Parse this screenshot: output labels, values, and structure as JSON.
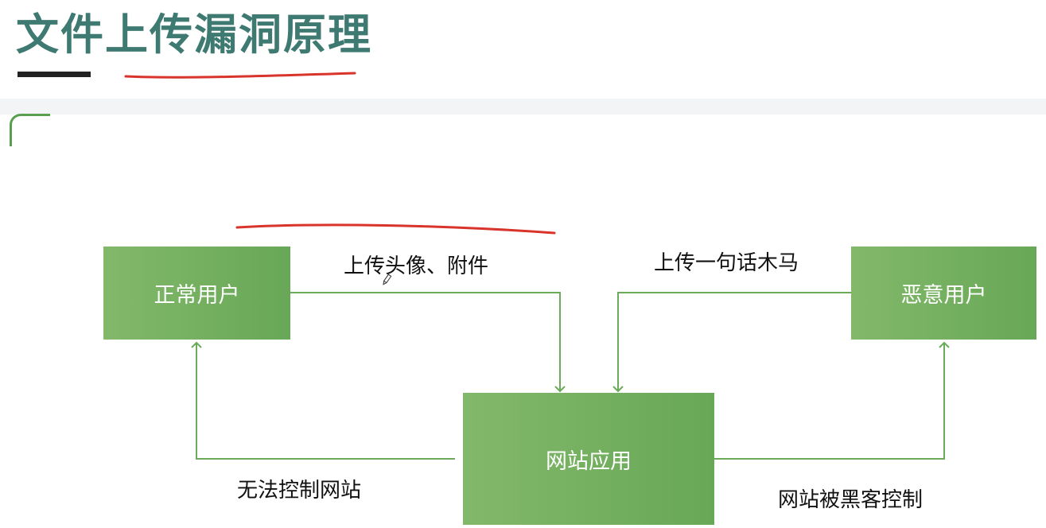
{
  "slide": {
    "title": "文件上传漏洞原理"
  },
  "diagram": {
    "nodes": {
      "normal_user": "正常用户",
      "malicious_user": "恶意用户",
      "website": "网站应用"
    },
    "edges": {
      "normal_upload": "上传头像、附件",
      "malicious_upload": "上传一句话木马",
      "normal_result": "无法控制网站",
      "malicious_result": "网站被黑客控制"
    }
  },
  "colors": {
    "title": "#3f7a72",
    "box_green": "#6aaa59",
    "arrow_green": "#6aaa59",
    "annotation_red": "#d9342b"
  }
}
